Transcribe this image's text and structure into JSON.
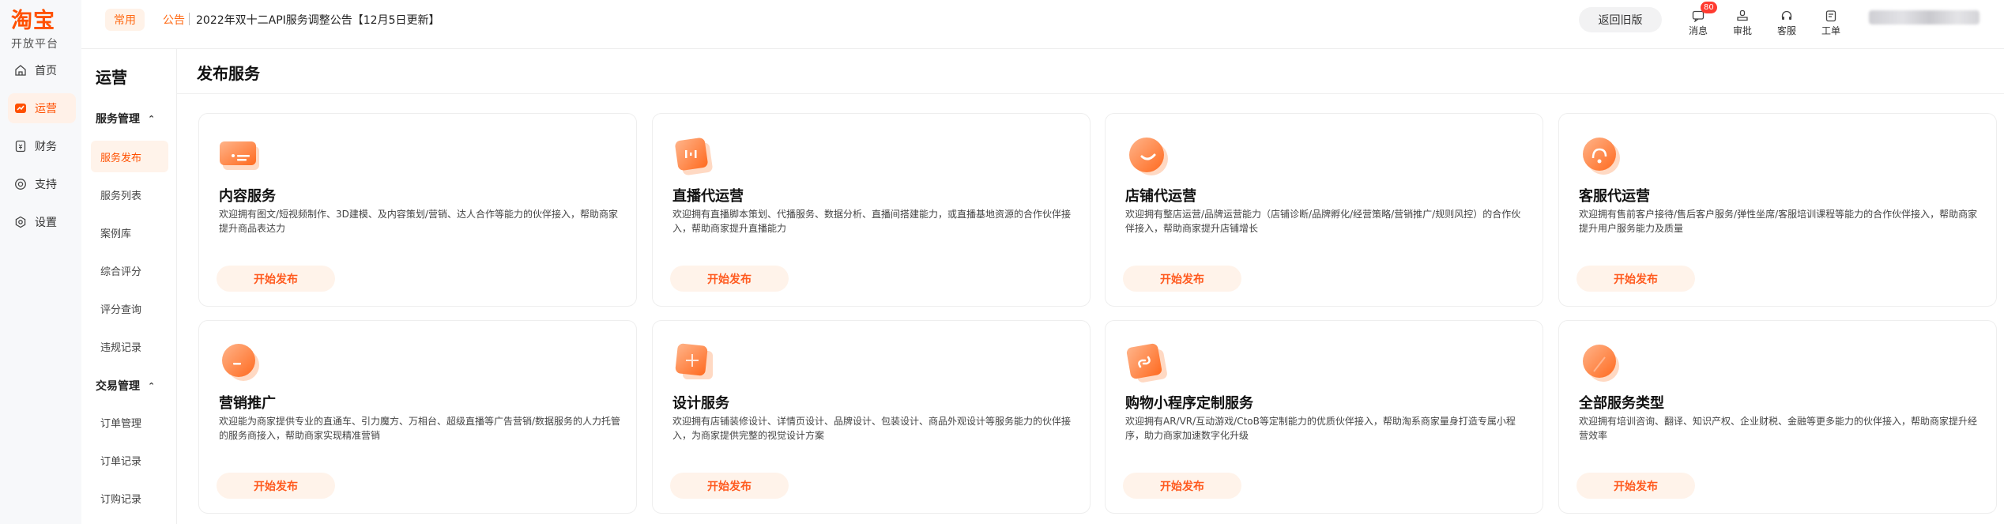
{
  "brand": {
    "logo": "淘宝",
    "subtitle": "开放平台"
  },
  "rail": {
    "items": [
      {
        "label": "首页",
        "icon": "home-icon"
      },
      {
        "label": "运营",
        "icon": "operations-icon",
        "active": true
      },
      {
        "label": "财务",
        "icon": "finance-icon"
      },
      {
        "label": "支持",
        "icon": "support-icon"
      },
      {
        "label": "设置",
        "icon": "settings-icon"
      }
    ]
  },
  "sidebar": {
    "title": "运营",
    "groups": [
      {
        "label": "服务管理",
        "items": [
          "服务发布",
          "服务列表",
          "案例库",
          "综合评分",
          "评分查询",
          "违规记录"
        ]
      },
      {
        "label": "交易管理",
        "items": [
          "订单管理",
          "订单记录",
          "订购记录"
        ]
      }
    ],
    "active_item": "服务发布"
  },
  "topbar": {
    "common_chip": "常用",
    "notice_label": "公告",
    "notice_text": "2022年双十二API服务调整公告【12月5日更新】",
    "old_version_button": "返回旧版",
    "tools": [
      {
        "label": "消息",
        "icon": "message-icon",
        "badge": "80"
      },
      {
        "label": "审批",
        "icon": "approval-icon"
      },
      {
        "label": "客服",
        "icon": "customer-service-icon"
      },
      {
        "label": "工单",
        "icon": "ticket-icon"
      }
    ]
  },
  "main": {
    "title": "发布服务",
    "cards": [
      {
        "title": "内容服务",
        "desc": "欢迎拥有图文/短视频制作、3D建模、及内容策划/营销、达人合作等能力的伙伴接入，帮助商家提升商品表达力",
        "button": "开始发布",
        "icon": "content-service-icon"
      },
      {
        "title": "直播代运营",
        "desc": "欢迎拥有直播脚本策划、代播服务、数据分析、直播间搭建能力，或直播基地资源的合作伙伴接入，帮助商家提升直播能力",
        "button": "开始发布",
        "icon": "live-operation-icon"
      },
      {
        "title": "店铺代运营",
        "desc": "欢迎拥有整店运营/品牌运营能力（店铺诊断/品牌孵化/经营策略/营销推广/规则风控）的合作伙伴接入，帮助商家提升店铺增长",
        "button": "开始发布",
        "icon": "store-operation-icon"
      },
      {
        "title": "客服代运营",
        "desc": "欢迎拥有售前客户接待/售后客户服务/弹性坐席/客服培训课程等能力的合作伙伴接入，帮助商家提升用户服务能力及质量",
        "button": "开始发布",
        "icon": "customer-operation-icon"
      },
      {
        "title": "营销推广",
        "desc": "欢迎能为商家提供专业的直通车、引力魔方、万相台、超级直播等广告营销/数据服务的人力托管的服务商接入，帮助商家实现精准营销",
        "button": "开始发布",
        "icon": "marketing-icon"
      },
      {
        "title": "设计服务",
        "desc": "欢迎拥有店铺装修设计、详情页设计、品牌设计、包装设计、商品外观设计等服务能力的伙伴接入，为商家提供完整的视觉设计方案",
        "button": "开始发布",
        "icon": "design-icon"
      },
      {
        "title": "购物小程序定制服务",
        "desc": "欢迎拥有AR/VR/互动游戏/CtoB等定制能力的优质伙伴接入，帮助淘系商家量身打造专属小程序，助力商家加速数字化升级",
        "button": "开始发布",
        "icon": "miniapp-icon"
      },
      {
        "title": "全部服务类型",
        "desc": "欢迎拥有培训咨询、翻译、知识产权、企业财税、金融等更多能力的伙伴接入，帮助商家提升经营效率",
        "button": "开始发布",
        "icon": "all-services-icon"
      }
    ]
  },
  "colors": {
    "accent": "#ff5000",
    "accent_light": "#fff3ea",
    "icon_gradient_from": "#ffb48a",
    "icon_gradient_to": "#ff6a1f"
  }
}
